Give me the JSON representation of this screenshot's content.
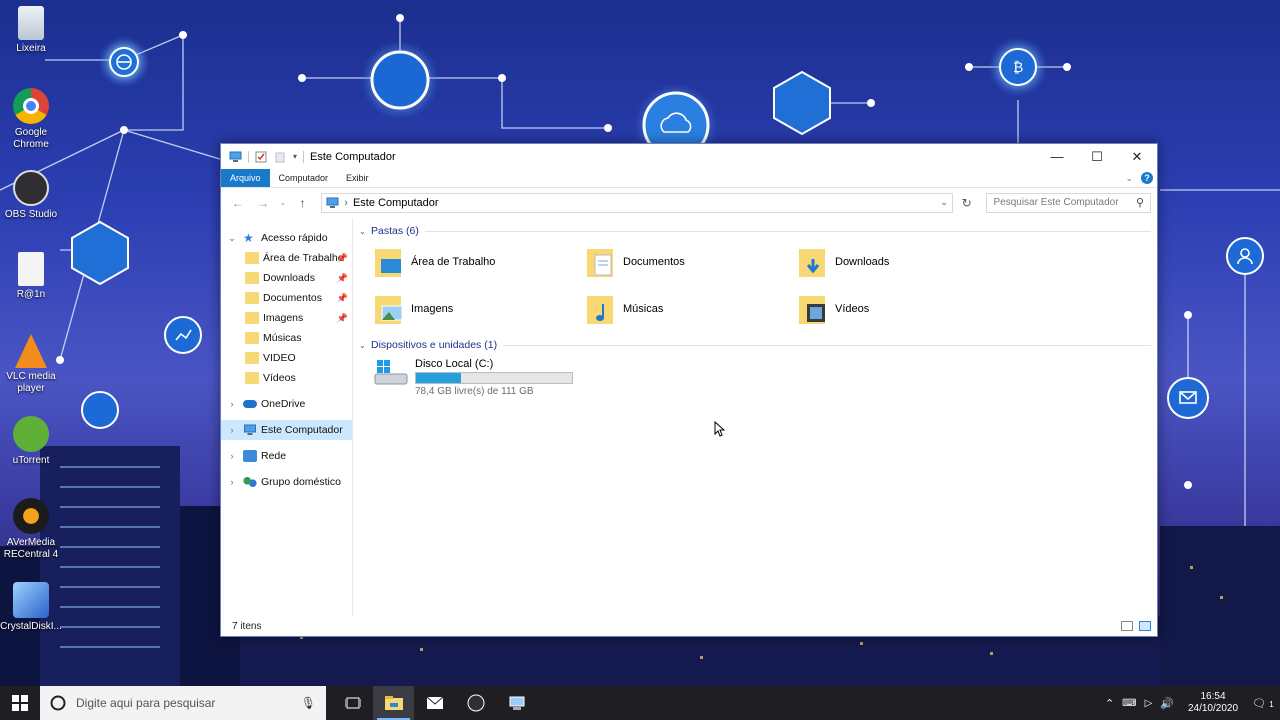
{
  "desktop_icons": [
    {
      "label": "Lixeira"
    },
    {
      "label": "Google Chrome"
    },
    {
      "label": "OBS Studio"
    },
    {
      "label": "R@1n"
    },
    {
      "label": "VLC media player"
    },
    {
      "label": "uTorrent"
    },
    {
      "label": "AVerMedia RECentral 4"
    },
    {
      "label": "CrystalDiskI..."
    }
  ],
  "window": {
    "title": "Este Computador",
    "ribbon_tabs": [
      "Arquivo",
      "Computador",
      "Exibir"
    ],
    "address": "Este Computador",
    "search_placeholder": "Pesquisar Este Computador"
  },
  "nav": {
    "quick_access": "Acesso rápido",
    "quick_items": [
      {
        "label": "Área de Trabalho",
        "pinned": true
      },
      {
        "label": "Downloads",
        "pinned": true
      },
      {
        "label": "Documentos",
        "pinned": true
      },
      {
        "label": "Imagens",
        "pinned": true
      },
      {
        "label": "Músicas",
        "pinned": false
      },
      {
        "label": "VIDEO",
        "pinned": false
      },
      {
        "label": "Vídeos",
        "pinned": false
      }
    ],
    "onedrive": "OneDrive",
    "this_pc": "Este Computador",
    "network": "Rede",
    "homegroup": "Grupo doméstico"
  },
  "content": {
    "folders_header": "Pastas (6)",
    "folders": [
      "Área de Trabalho",
      "Documentos",
      "Downloads",
      "Imagens",
      "Músicas",
      "Vídeos"
    ],
    "devices_header": "Dispositivos e unidades (1)",
    "drive": {
      "name": "Disco Local (C:)",
      "free_text": "78,4 GB livre(s) de 111 GB",
      "used_fraction": 0.29
    }
  },
  "status": {
    "items": "7 itens"
  },
  "taskbar": {
    "search_placeholder": "Digite aqui para pesquisar",
    "time": "16:54",
    "date": "24/10/2020",
    "notification_count": "1"
  },
  "colors": {
    "accent": "#1979ca",
    "selection": "#cce8ff",
    "drive_bar": "#26a0da"
  }
}
